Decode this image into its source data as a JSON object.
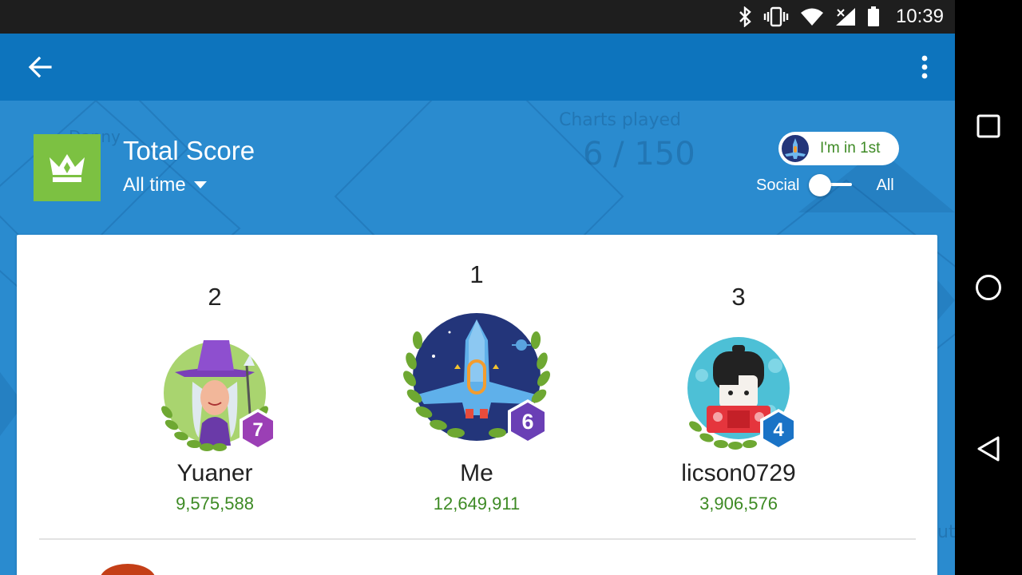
{
  "status_bar": {
    "time": "10:39",
    "icons": [
      "bluetooth-icon",
      "vibrate-icon",
      "wifi-icon",
      "signal-icon",
      "battery-icon"
    ]
  },
  "app_bar": {
    "back_icon": "arrow-back-icon",
    "menu_icon": "more-vert-icon"
  },
  "background": {
    "ghost_name": "Danny",
    "ghost_stat_label": "Charts played",
    "ghost_stat_value": "6 / 150",
    "ghost_edge_text": "ut"
  },
  "header": {
    "title": "Total Score",
    "period": "All time",
    "rank_chip_label": "I'm in 1st",
    "toggle_left": "Social",
    "toggle_right": "All",
    "toggle_state": "Social",
    "accent_color": "#7cc142"
  },
  "podium": [
    {
      "place": "2",
      "name": "Yuaner",
      "score": "9,575,588",
      "level": "7",
      "badge_color": "#9b3fb5",
      "avatar": "witch-avatar"
    },
    {
      "place": "1",
      "name": "Me",
      "score": "12,649,911",
      "level": "6",
      "badge_color": "#6a3fb5",
      "avatar": "spaceship-avatar"
    },
    {
      "place": "3",
      "name": "licson0729",
      "score": "3,906,576",
      "level": "4",
      "badge_color": "#1a73c6",
      "avatar": "kokeshi-avatar"
    }
  ],
  "colors": {
    "app_bar": "#0d74bd",
    "background": "#2a8bcf",
    "score_text": "#3d8a24",
    "laurel": "#8bc34a"
  },
  "nav_bar": {
    "recents_icon": "recents-square-icon",
    "home_icon": "home-circle-icon",
    "back_icon": "back-triangle-icon"
  }
}
